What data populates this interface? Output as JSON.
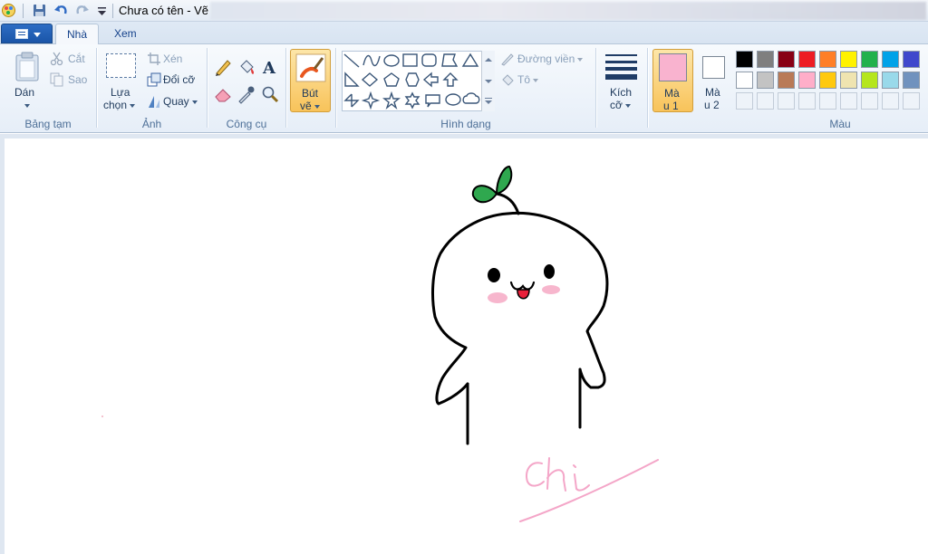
{
  "window": {
    "title": "Chưa có tên - Vẽ"
  },
  "tabs": {
    "home": "Nhà",
    "view": "Xem"
  },
  "clipboard": {
    "paste": "Dán",
    "cut": "Cắt",
    "copy": "Sao",
    "group_label": "Bảng tạm"
  },
  "image": {
    "select_line1": "Lựa",
    "select_line2": "chọn",
    "crop": "Xén",
    "resize": "Đổi cỡ",
    "rotate": "Quay",
    "group_label": "Ảnh"
  },
  "tools": {
    "group_label": "Công cụ"
  },
  "brushes": {
    "line1": "Bút",
    "line2": "vẽ"
  },
  "shapes": {
    "outline": "Đường viền",
    "fill": "Tô",
    "group_label": "Hình dạng"
  },
  "size": {
    "line1": "Kích",
    "line2": "cỡ"
  },
  "color1": {
    "line1": "Mà",
    "line2": "u 1",
    "value": "#f9b3cf"
  },
  "color2": {
    "line1": "Mà",
    "line2": "u 2",
    "value": "#ffffff"
  },
  "colors": {
    "group_label": "Màu",
    "palette_row1": [
      "#000000",
      "#7f7f7f",
      "#880015",
      "#ed1c24",
      "#ff7f27",
      "#fff200",
      "#22b14c",
      "#00a2e8",
      "#3f48cc"
    ],
    "palette_row2": [
      "#ffffff",
      "#c3c3c3",
      "#b97a57",
      "#ffaec9",
      "#ffc90e",
      "#efe4b0",
      "#b5e61d",
      "#99d9ea",
      "#7092be"
    ]
  },
  "drawing": {
    "signature": "Chi",
    "ink_color": "#000000",
    "leaf_color": "#2fa84f",
    "blush_color": "#f6a9c4",
    "tongue_color": "#e8203a",
    "signature_color": "#f4a6c8"
  }
}
